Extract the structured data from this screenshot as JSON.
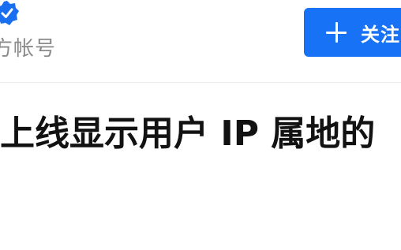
{
  "header": {
    "account_label": "方帐号",
    "follow_button": {
      "label": "关注",
      "icon": "plus-icon"
    },
    "verified_icon": "verified-check-icon"
  },
  "article": {
    "title": "上线显示用户 IP 属地的"
  },
  "colors": {
    "accent": "#1772f6",
    "badge": "#1a6ff0",
    "secondary_text": "#8a8a8a",
    "title_text": "#121212",
    "divider": "#ececec"
  }
}
